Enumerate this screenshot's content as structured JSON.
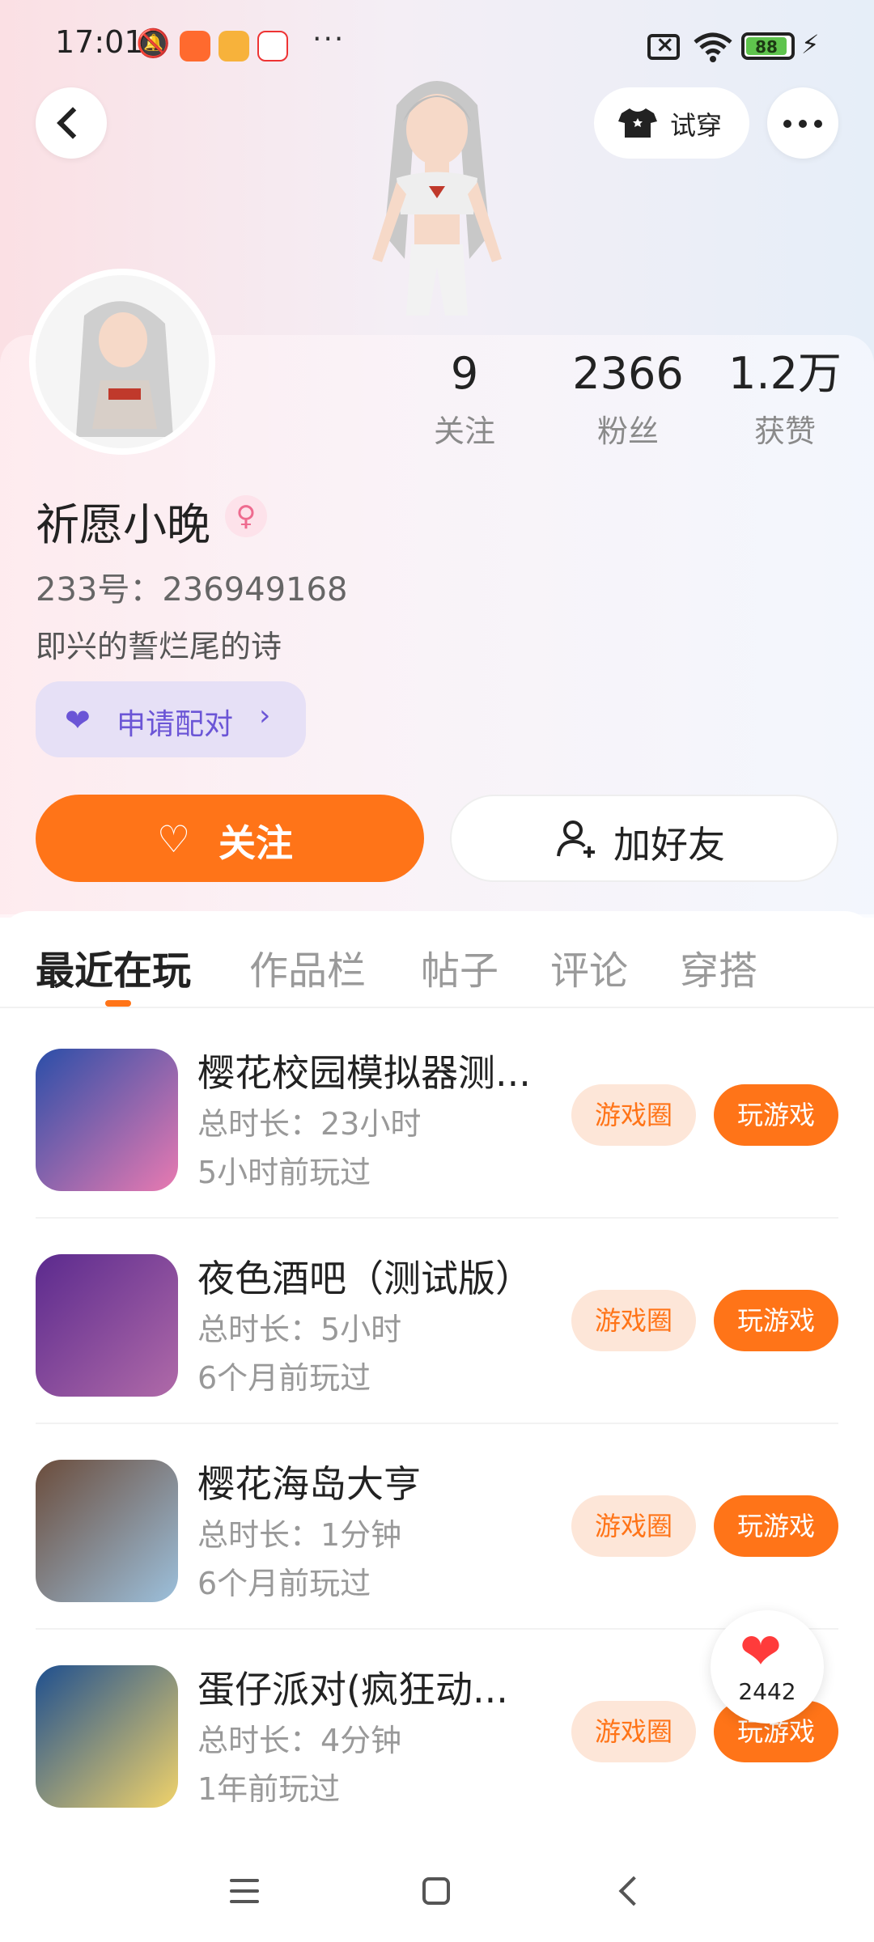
{
  "status_bar": {
    "time": "17:01",
    "battery": "88",
    "icons": [
      "mute-icon",
      "app-icon",
      "app-icon",
      "app-icon",
      "more-dots-icon",
      "sim-off-icon",
      "wifi-icon",
      "battery-icon",
      "charging-icon"
    ]
  },
  "header": {
    "try_on_label": "试穿"
  },
  "profile": {
    "stats": [
      {
        "value": "9",
        "label": "关注"
      },
      {
        "value": "2366",
        "label": "粉丝"
      },
      {
        "value": "1.2万",
        "label": "获赞"
      }
    ],
    "name": "祈愿小晚",
    "gender_icon": "female-icon",
    "uid": "233号：236949168",
    "bio": "即兴的誓烂尾的诗",
    "pair_label": "申请配对",
    "follow_label": "关注",
    "add_friend_label": "加好友"
  },
  "tabs": [
    "最近在玩",
    "作品栏",
    "帖子",
    "评论",
    "穿搭"
  ],
  "games": [
    {
      "title": "樱花校园模拟器测...",
      "duration": "总时长：23小时",
      "last_played": "5小时前玩过",
      "circle_label": "游戏圈",
      "play_label": "玩游戏",
      "thumb_color": "#4d72c9"
    },
    {
      "title": "夜色酒吧（测试版）",
      "duration": "总时长：5小时",
      "last_played": "6个月前玩过",
      "circle_label": "游戏圈",
      "play_label": "玩游戏",
      "thumb_color": "#6b3fa0"
    },
    {
      "title": "樱花海岛大亨",
      "duration": "总时长：1分钟",
      "last_played": "6个月前玩过",
      "circle_label": "游戏圈",
      "play_label": "玩游戏",
      "thumb_color": "#8fb0c9"
    },
    {
      "title": "蛋仔派对(疯狂动...",
      "duration": "总时长：4分钟",
      "last_played": "1年前玩过",
      "circle_label": "游戏圈",
      "play_label": "玩游戏",
      "thumb_color": "#2a6fb0"
    }
  ],
  "like_fab": {
    "count": "2442"
  },
  "colors": {
    "accent": "#ff7418",
    "pair_purple": "#6b55d6"
  }
}
